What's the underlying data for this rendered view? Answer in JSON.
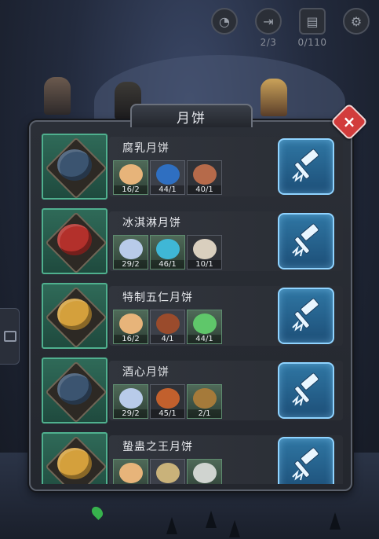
{
  "hud": {
    "items": [
      {
        "icon": "timer-icon",
        "label": ""
      },
      {
        "icon": "door-exit-icon",
        "label": "2/3"
      },
      {
        "icon": "calendar-icon",
        "label": "0/110"
      },
      {
        "icon": "gear-icon",
        "label": ""
      }
    ]
  },
  "modal": {
    "title": "月饼",
    "close_icon": "×"
  },
  "recipes": [
    {
      "name": "腐乳月饼",
      "cake_color": "#3b5470",
      "materials": [
        {
          "count": "16/2",
          "icon": "flour-pile-icon",
          "bg": "green",
          "color": "#e7b47a"
        },
        {
          "count": "44/1",
          "icon": "water-tank-icon",
          "bg": "plain",
          "color": "#2f6fc1"
        },
        {
          "count": "40/1",
          "icon": "spiked-ball-icon",
          "bg": "dark",
          "color": "#b66a4a"
        }
      ]
    },
    {
      "name": "冰淇淋月饼",
      "cake_color": "#b3302b",
      "materials": [
        {
          "count": "29/2",
          "icon": "sugar-pile-icon",
          "bg": "green",
          "color": "#b8cbe9"
        },
        {
          "count": "46/1",
          "icon": "ice-crystal-icon",
          "bg": "green",
          "color": "#3fb7d6"
        },
        {
          "count": "10/1",
          "icon": "paint-palette-icon",
          "bg": "dark",
          "color": "#d9cfbe"
        }
      ]
    },
    {
      "name": "特制五仁月饼",
      "cake_color": "#d4a03c",
      "materials": [
        {
          "count": "16/2",
          "icon": "flour-pile-icon",
          "bg": "green",
          "color": "#e7b47a"
        },
        {
          "count": "4/1",
          "icon": "cake-slice-icon",
          "bg": "plain",
          "color": "#9a4b2c"
        },
        {
          "count": "44/1",
          "icon": "potion-flask-icon",
          "bg": "green",
          "color": "#5fc76a"
        }
      ]
    },
    {
      "name": "酒心月饼",
      "cake_color": "#3b5470",
      "materials": [
        {
          "count": "29/2",
          "icon": "sugar-pile-icon",
          "bg": "green",
          "color": "#b8cbe9"
        },
        {
          "count": "45/1",
          "icon": "liquor-jar-icon",
          "bg": "dark",
          "color": "#c2602d"
        },
        {
          "count": "2/1",
          "icon": "wine-bottle-icon",
          "bg": "green",
          "color": "#a57a3a"
        }
      ]
    },
    {
      "name": "蛰蛊之王月饼",
      "cake_color": "#d4a03c",
      "materials": [
        {
          "count": "",
          "icon": "flour-pile-icon",
          "bg": "green",
          "color": "#e7b47a"
        },
        {
          "count": "",
          "icon": "tray-icon",
          "bg": "plain",
          "color": "#c9b27a"
        },
        {
          "count": "",
          "icon": "herb-sprig-icon",
          "bg": "green",
          "color": "#d0d4d0"
        }
      ]
    }
  ],
  "craft_icon": "hammer-icon"
}
